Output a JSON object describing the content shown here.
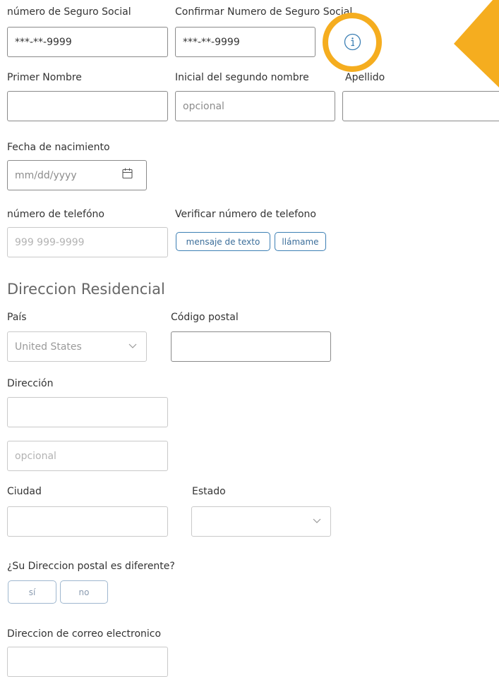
{
  "ssn": {
    "label": "número de Seguro Social",
    "value": "***-**-9999",
    "confirm_label": "Confirmar Numero de Seguro Social",
    "confirm_value": "***-**-9999"
  },
  "name": {
    "first_label": "Primer Nombre",
    "middle_label": "Inicial del segundo nombre",
    "middle_placeholder": "opcional",
    "last_label": "Apellido"
  },
  "dob": {
    "label": "Fecha de nacimiento",
    "placeholder": "mm/dd/yyyy"
  },
  "phone": {
    "label": "número de telefóno",
    "placeholder": "999 999-9999",
    "verify_label": "Verificar número de telefono",
    "text_button": "mensaje de texto",
    "call_button": "llámame"
  },
  "residential": {
    "title": "Direccion Residencial",
    "country_label": "País",
    "country_value": "United States",
    "zip_label": "Código postal",
    "address_label": "Dirección",
    "address2_placeholder": "opcional",
    "city_label": "Ciudad",
    "state_label": "Estado"
  },
  "mailing": {
    "question": "¿Su Direccion postal es diferente?",
    "yes": "sí",
    "no": "no"
  },
  "email": {
    "label": "Direccion de correo electronico"
  },
  "colors": {
    "highlight_ring": "#f5ad1f",
    "link_blue": "#3c7fb4"
  }
}
